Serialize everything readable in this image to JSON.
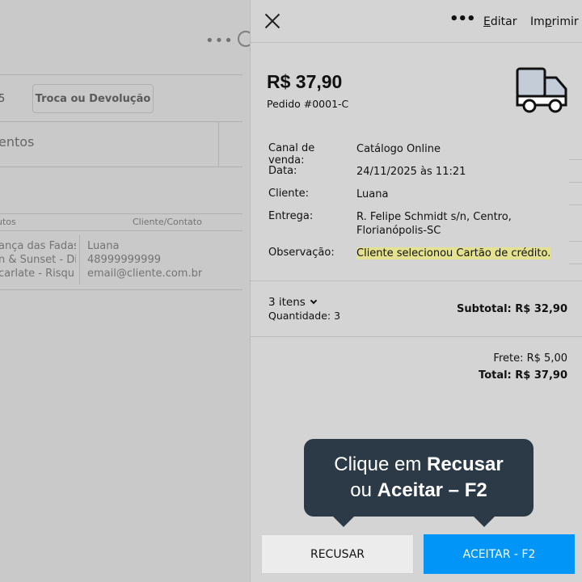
{
  "background": {
    "tab_partial": "5",
    "tab_troca": "Troca ou Devolução",
    "page_title_partial": "entos",
    "table_headers": [
      "utos",
      "Cliente/Contato"
    ],
    "rows": [
      [
        "ança das Fadas",
        "Luana"
      ],
      [
        "n & Sunset - Di",
        "48999999999"
      ],
      [
        "carlate - Risqu",
        "email@cliente.com.br"
      ]
    ]
  },
  "topbar": {
    "close_icon": "close-icon",
    "more_icon": "more-horizontal-icon",
    "more_label": "•••",
    "edit_label": "Editar",
    "edit_mnemonic": "E",
    "edit_rest": "ditar",
    "print_label": "Imprimir",
    "print_head": "Im",
    "print_mnemonic": "p",
    "print_tail": "rimir"
  },
  "order": {
    "total": "R$ 37,90",
    "number": "Pedido #0001-C",
    "icon": "delivery-truck-icon",
    "details": [
      {
        "label": "Canal de venda:",
        "value": "Catálogo Online"
      },
      {
        "label": "Data:",
        "value": "24/11/2025 às 11:21"
      },
      {
        "label": "Cliente:",
        "value": "Luana"
      },
      {
        "label": "Entrega:",
        "value": "R. Felipe Schmidt s/n, Centro, Florianópolis-SC"
      },
      {
        "label": "Observação:",
        "value": "Cliente selecionou Cartão de crédito."
      }
    ],
    "items_label": "3 itens",
    "quantity": "Quantidade: 3",
    "subtotal": "Subtotal: R$ 32,90",
    "shipping": "Frete: R$ 5,00",
    "grand_total": "Total: R$ 37,90"
  },
  "tooltip": {
    "line1_prefix": "Clique em ",
    "line1_bold": "Recusar",
    "line2_prefix": "ou ",
    "line2_bold": "Aceitar – F2"
  },
  "actions": {
    "reject_label": "RECUSAR",
    "accept_label": "ACEITAR - F2"
  },
  "colors": {
    "accept": "#0095f6",
    "tooltip": "#2c3a47",
    "highlight": "#e4e190"
  }
}
